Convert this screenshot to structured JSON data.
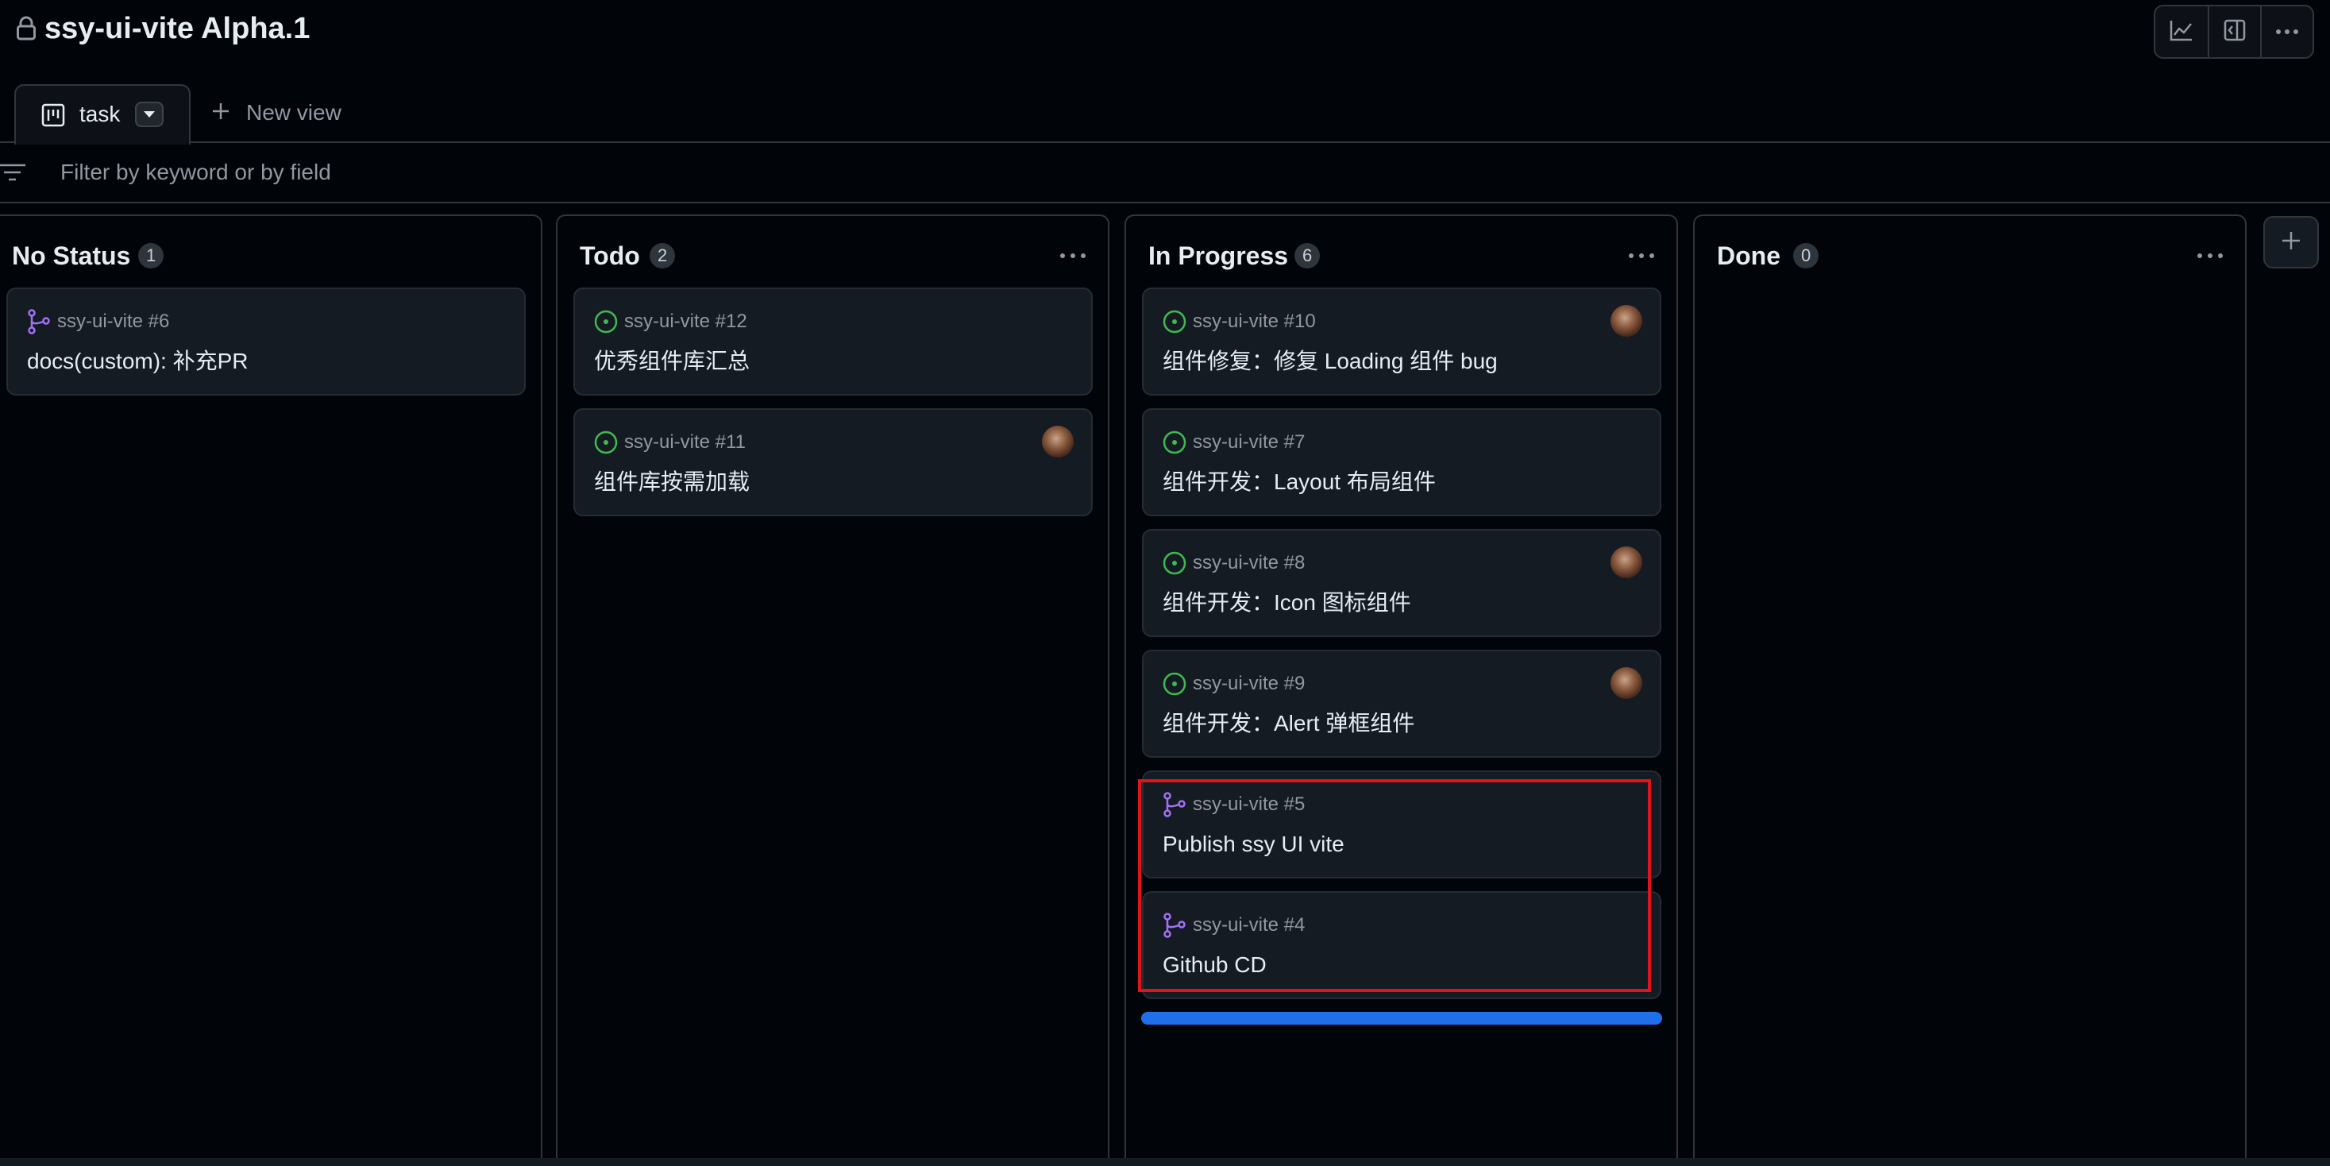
{
  "header": {
    "title": "ssy-ui-vite Alpha.1",
    "icons": [
      "lock-icon",
      "graph-icon",
      "sidebar-expand-icon",
      "kebab-horizontal-icon"
    ]
  },
  "tabs": [
    {
      "label": "task",
      "icon": "project-board-icon",
      "active": true
    }
  ],
  "new_view_label": "New view",
  "filter": {
    "placeholder": "Filter by keyword or by field",
    "value": ""
  },
  "columns": [
    {
      "name": "No Status",
      "count": "1",
      "cards": [
        {
          "ref": "ssy-ui-vite #6",
          "title": "docs(custom): 补充PR",
          "type": "pull-request",
          "assignee": false
        }
      ]
    },
    {
      "name": "Todo",
      "count": "2",
      "cards": [
        {
          "ref": "ssy-ui-vite #12",
          "title": "优秀组件库汇总",
          "type": "issue",
          "assignee": false
        },
        {
          "ref": "ssy-ui-vite #11",
          "title": "组件库按需加载",
          "type": "issue",
          "assignee": true
        }
      ]
    },
    {
      "name": "In Progress",
      "count": "6",
      "cards": [
        {
          "ref": "ssy-ui-vite #10",
          "title": "组件修复：修复 Loading 组件 bug",
          "type": "issue",
          "assignee": true
        },
        {
          "ref": "ssy-ui-vite #7",
          "title": "组件开发：Layout 布局组件",
          "type": "issue",
          "assignee": false
        },
        {
          "ref": "ssy-ui-vite #8",
          "title": "组件开发：Icon 图标组件",
          "type": "issue",
          "assignee": true
        },
        {
          "ref": "ssy-ui-vite #9",
          "title": "组件开发：Alert 弹框组件",
          "type": "issue",
          "assignee": true
        },
        {
          "ref": "ssy-ui-vite #5",
          "title": "Publish ssy UI vite",
          "type": "pull-request",
          "assignee": false
        },
        {
          "ref": "ssy-ui-vite #4",
          "title": "Github CD",
          "type": "pull-request",
          "assignee": false
        }
      ]
    },
    {
      "name": "Done",
      "count": "0",
      "cards": []
    }
  ],
  "colors": {
    "background": "#010409",
    "issue_open": "#3fb950",
    "pull_request": "#a371f7",
    "accent": "#1f6feb",
    "highlight": "#e0141a"
  }
}
